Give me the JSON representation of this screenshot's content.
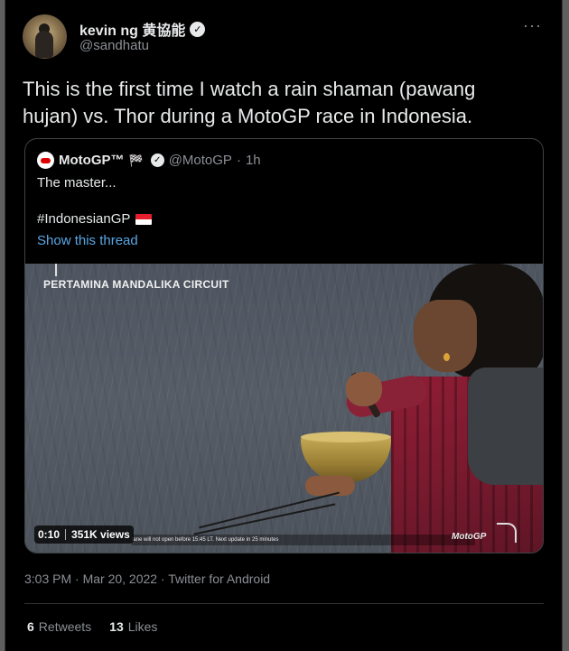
{
  "author": {
    "display_name": "kevin ng 黄協能",
    "handle": "@sandhatu",
    "verified_icon": "verified-badge-icon",
    "more_label": "···"
  },
  "tweet": {
    "text": "This is the first time I watch a rain shaman (pawang hujan) vs. Thor during a MotoGP race in Indonesia."
  },
  "quoted": {
    "display_name": "MotoGP™",
    "flag_glyph": "🏁",
    "handle": "@MotoGP",
    "separator": "·",
    "time": "1h",
    "text": "The master...",
    "hashtag": "#IndonesianGP",
    "show_thread": "Show this thread",
    "media": {
      "overlay_title": "PERTAMINA MANDALIKA CIRCUIT",
      "ticker": "lane will not open before 15:45 LT. Next update in 25 minutes",
      "watermark": "MotoGP",
      "duration": "0:10",
      "views": "351K views"
    }
  },
  "meta": {
    "timestamp": "3:03 PM · Mar 20, 2022 · Twitter for Android"
  },
  "stats": {
    "retweets_count": "6",
    "retweets_label": "Retweets",
    "likes_count": "13",
    "likes_label": "Likes"
  },
  "colors": {
    "background": "#000000",
    "text": "#e7e9ea",
    "secondary": "#8b8f94",
    "link": "#5aa7e6"
  }
}
